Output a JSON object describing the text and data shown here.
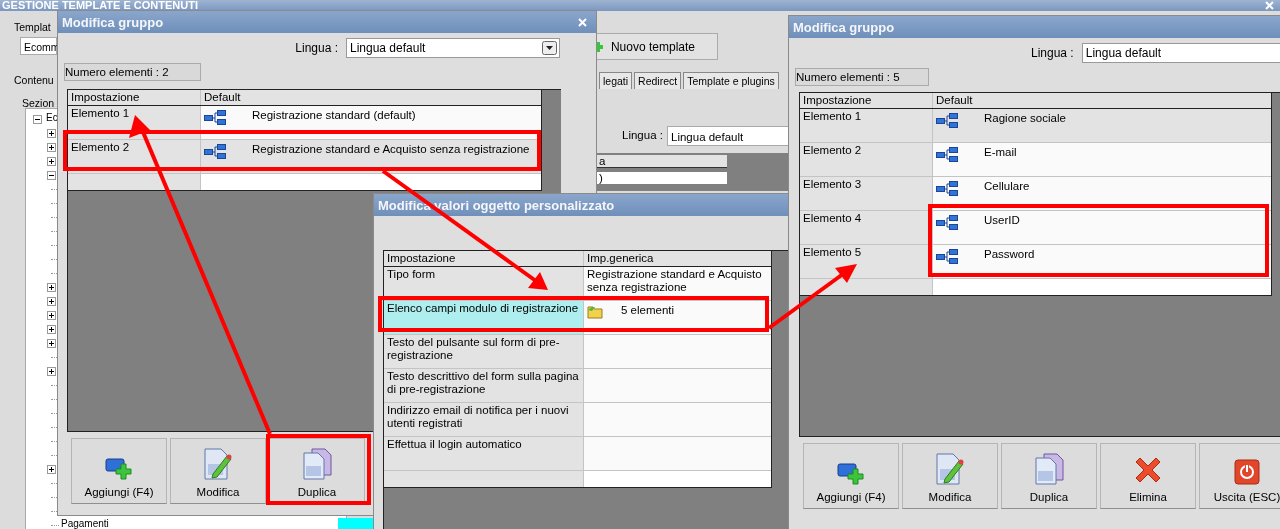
{
  "background_app": {
    "title": "GESTIONE TEMPLATE E CONTENUTI",
    "template_label": "Templat",
    "template_value": "Ecomm",
    "contents_tab": "Contenu",
    "sections_label": "Sezion",
    "tree": [
      {
        "kind": "folder",
        "expanded": true,
        "label": "Ec"
      },
      {
        "kind": "folder",
        "expanded": false
      },
      {
        "kind": "folder",
        "expanded": false
      },
      {
        "kind": "folder",
        "expanded": false
      },
      {
        "kind": "folder",
        "expanded": true
      },
      {
        "kind": "leaf"
      },
      {
        "kind": "leaf"
      },
      {
        "kind": "leaf"
      },
      {
        "kind": "leaf"
      },
      {
        "kind": "leaf"
      },
      {
        "kind": "leaf"
      },
      {
        "kind": "leaf"
      },
      {
        "kind": "folder",
        "expanded": false
      },
      {
        "kind": "folder",
        "expanded": false
      },
      {
        "kind": "folder",
        "expanded": false
      },
      {
        "kind": "folder",
        "expanded": false
      },
      {
        "kind": "folder",
        "expanded": false
      },
      {
        "kind": "leaf"
      },
      {
        "kind": "folder",
        "expanded": false
      },
      {
        "kind": "leaf"
      },
      {
        "kind": "leaf"
      },
      {
        "kind": "leaf"
      },
      {
        "kind": "leaf"
      },
      {
        "kind": "leaf"
      },
      {
        "kind": "leaf"
      },
      {
        "kind": "folder",
        "expanded": false
      },
      {
        "kind": "leaf"
      },
      {
        "kind": "leaf"
      },
      {
        "kind": "leaf"
      },
      {
        "kind": "leaf",
        "label": "Pagamenti"
      }
    ],
    "new_template_button": "Nuovo template",
    "tabs": [
      {
        "label": "legati",
        "selected": false
      },
      {
        "label": "Redirect",
        "selected": false
      },
      {
        "label": "Template e plugins",
        "selected": false
      }
    ],
    "language_label": "Lingua :",
    "language_value": "Lingua default",
    "column_header": "a",
    "cell_fragment": ")"
  },
  "left_dialog": {
    "title": "Modifica gruppo",
    "language_label": "Lingua :",
    "language_value": "Lingua default",
    "count": "Numero elementi : 2",
    "columns": [
      "Impostazione",
      "Default"
    ],
    "rows": [
      {
        "setting": "Elemento 1",
        "value": "Registrazione standard (default)",
        "selected": false
      },
      {
        "setting": "Elemento 2",
        "value": "Registrazione standard e Acquisto senza registrazione",
        "selected": true
      }
    ],
    "buttons": [
      {
        "kind": "add",
        "label": "Aggiungi (F4)"
      },
      {
        "kind": "edit",
        "label": "Modifica"
      },
      {
        "kind": "duplicate",
        "label": "Duplica"
      }
    ]
  },
  "middle_dialog": {
    "title": "Modifica valori oggetto personalizzato",
    "columns": [
      "Impostazione",
      "Imp.generica"
    ],
    "rows": [
      {
        "setting": "Tipo form",
        "kind": "text",
        "value": "Registrazione standard e Acquisto senza registrazione",
        "selected": false
      },
      {
        "setting": "Elenco campi modulo di registrazione",
        "kind": "folder",
        "value": "5 elementi",
        "selected": true
      },
      {
        "setting": "Testo del pulsante sul form di pre-registrazione",
        "kind": "text",
        "selected": false
      },
      {
        "setting": "Testo descrittivo del form sulla pagina di pre-registrazione",
        "kind": "text",
        "selected": false
      },
      {
        "setting": "Indirizzo email di notifica per i nuovi utenti registrati",
        "kind": "text",
        "selected": false
      },
      {
        "setting": "Effettua il login automatico",
        "kind": "text",
        "selected": false
      }
    ]
  },
  "right_dialog": {
    "title": "Modifica gruppo",
    "language_label": "Lingua :",
    "language_value": "Lingua default",
    "count": "Numero elementi : 5",
    "columns": [
      "Impostazione",
      "Default"
    ],
    "rows": [
      {
        "setting": "Elemento 1",
        "value": "Ragione sociale",
        "selected": true
      },
      {
        "setting": "Elemento 2",
        "value": "E-mail",
        "selected": false
      },
      {
        "setting": "Elemento 3",
        "value": "Cellulare",
        "selected": false
      },
      {
        "setting": "Elemento 4",
        "value": "UserID",
        "selected": false
      },
      {
        "setting": "Elemento 5",
        "value": "Password",
        "selected": false
      }
    ],
    "buttons": [
      {
        "kind": "add",
        "label": "Aggiungi (F4)"
      },
      {
        "kind": "edit",
        "label": "Modifica"
      },
      {
        "kind": "duplicate",
        "label": "Duplica"
      },
      {
        "kind": "delete",
        "label": "Elimina"
      },
      {
        "kind": "exit",
        "label": "Uscita (ESC)"
      }
    ]
  }
}
